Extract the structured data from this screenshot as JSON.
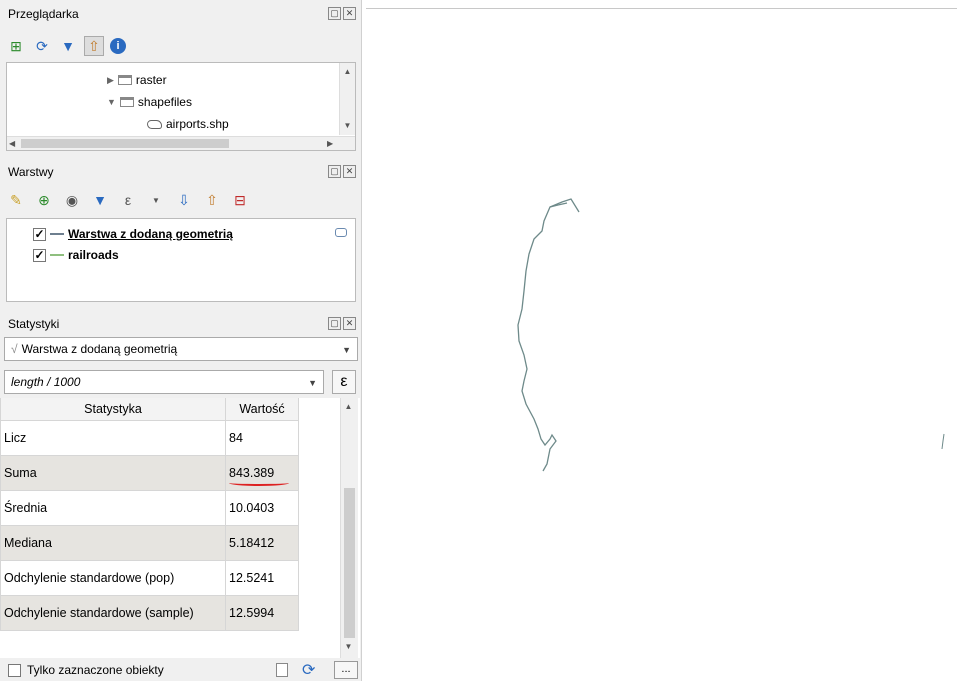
{
  "browser": {
    "title": "Przeglądarka",
    "tree": [
      {
        "label": "raster",
        "expanded": false
      },
      {
        "label": "shapefiles",
        "expanded": true
      },
      {
        "label": "airports.shp"
      }
    ]
  },
  "layers": {
    "title": "Warstwy",
    "items": [
      {
        "label": "Warstwa z dodaną geometrią",
        "checked": true,
        "color": "#6e7f8f"
      },
      {
        "label": "railroads",
        "checked": true,
        "color": "#8fbf7f"
      }
    ]
  },
  "stats": {
    "title": "Statystyki",
    "layer_combo": "Warstwa z dodaną geometrią",
    "expression": "length / 1000",
    "expression_btn": "ε",
    "columns": [
      "Statystyka",
      "Wartość"
    ],
    "rows": [
      {
        "name": "Licz",
        "value": "84"
      },
      {
        "name": "Suma",
        "value": "843.389"
      },
      {
        "name": "Średnia",
        "value": "10.0403"
      },
      {
        "name": "Mediana",
        "value": "5.18412"
      },
      {
        "name": "Odchylenie standardowe (pop)",
        "value": "12.5241"
      },
      {
        "name": "Odchylenie standardowe (sample)",
        "value": "12.5994"
      }
    ],
    "selected_only_label": "Tylko zaznaczone obiekty",
    "more_btn": "..."
  },
  "colors": {
    "line_feature": "#6e8a8a",
    "annotation_underline": "#d22"
  }
}
